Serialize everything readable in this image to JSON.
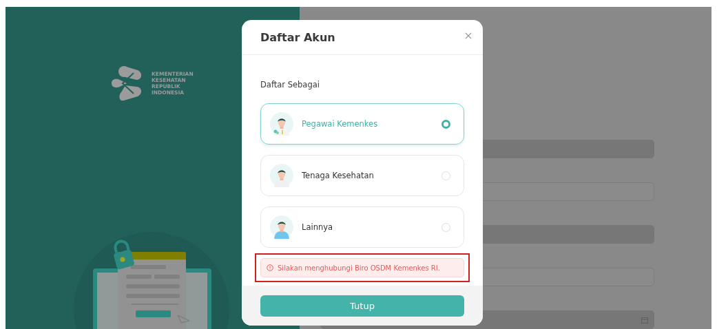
{
  "background": {
    "logo_lines": [
      "KEMENTERIAN",
      "KESEHATAN",
      "REPUBLIK",
      "INDONESIA"
    ],
    "form_fields": [
      {
        "kind": "filled"
      },
      {
        "kind": "outlined"
      },
      {
        "kind": "filled"
      },
      {
        "kind": "outlined"
      },
      {
        "kind": "date"
      }
    ]
  },
  "modal": {
    "title": "Daftar Akun",
    "section_label": "Daftar Sebagai",
    "options": [
      {
        "label": "Pegawai Kemenkes",
        "kind": "staff",
        "selected": true
      },
      {
        "label": "Tenaga Kesehatan",
        "kind": "health-worker",
        "selected": false
      },
      {
        "label": "Lainnya",
        "kind": "other",
        "selected": false
      }
    ],
    "alert": {
      "message": "Silakan menghubungi Biro OSDM Kemenkes RI.",
      "highlighted": true
    },
    "button": "Tutup"
  }
}
